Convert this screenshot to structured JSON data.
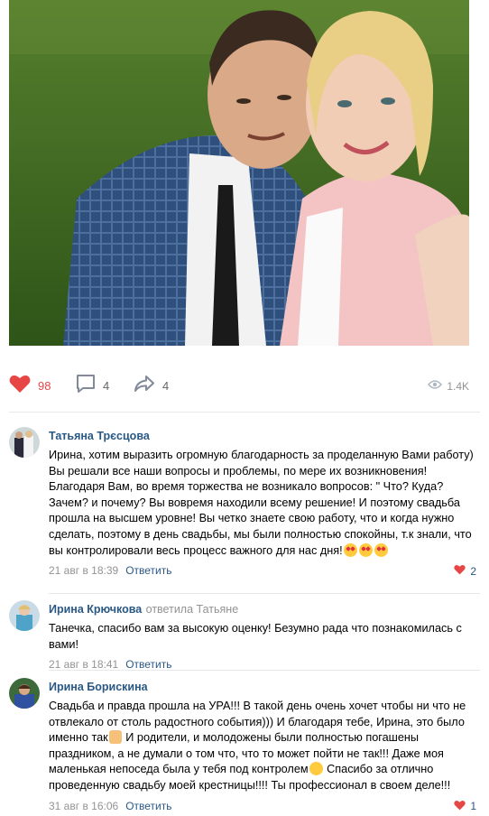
{
  "post": {
    "likes": "98",
    "comments": "4",
    "shares": "4",
    "views": "1.4K"
  },
  "comments": [
    {
      "author": "Татьяна Трєсцова",
      "text_parts": [
        "Ирина, хотим выразить огромную благодарность за проделанную Вами работу) Вы решали все наши вопросы и проблемы, по мере их возникновения! Благодаря Вам, во время торжества не возникало вопросов: \" Что? Куда? Зачем? и почему? Вы вовремя находили всему решение! И поэтому свадьба прошла на высшем уровне! Вы четко знаете свою работу, что и когда нужно сделать, поэтому в день свадьбы, мы были полностью спокойны, т.к знали, что вы контролировали весь процесс важного для нас дня!"
      ],
      "date": "21 авг в 18:39",
      "reply_label": "Ответить",
      "likes": "2"
    },
    {
      "author": "Ирина Крючкова",
      "replied_prefix": "ответила",
      "replied_to": "Татьяне",
      "text": "Танечка, спасибо вам за высокую оценку! Безумно рада что познакомилась с вами!",
      "date": "21 авг в 18:41",
      "reply_label": "Ответить"
    },
    {
      "author": "Ирина Борискина",
      "text_part1": "Свадьба и правда прошла на УРА!!! В такой день очень хочет чтобы ни что не отвлекало от столь радостного события))) И благодаря тебе, Ирина, это было именно так",
      "text_part2": " И родители, и молодожены были полностью погашены праздником, а не думали о том что, что то может пойти не так!!! Даже моя маленькая непоседа была у тебя под контролем",
      "text_part3": " Спасибо за отлично проведенную свадьбу моей крестницы!!!! Ты профессионал в своем деле!!!",
      "date": "31 авг в 16:06",
      "reply_label": "Ответить",
      "likes": "1"
    }
  ],
  "icons": {
    "like": "heart-icon",
    "comment": "comment-icon",
    "share": "share-icon",
    "views": "eye-icon"
  },
  "colors": {
    "link": "#2a5885",
    "like": "#e64646",
    "meta": "#939393"
  }
}
